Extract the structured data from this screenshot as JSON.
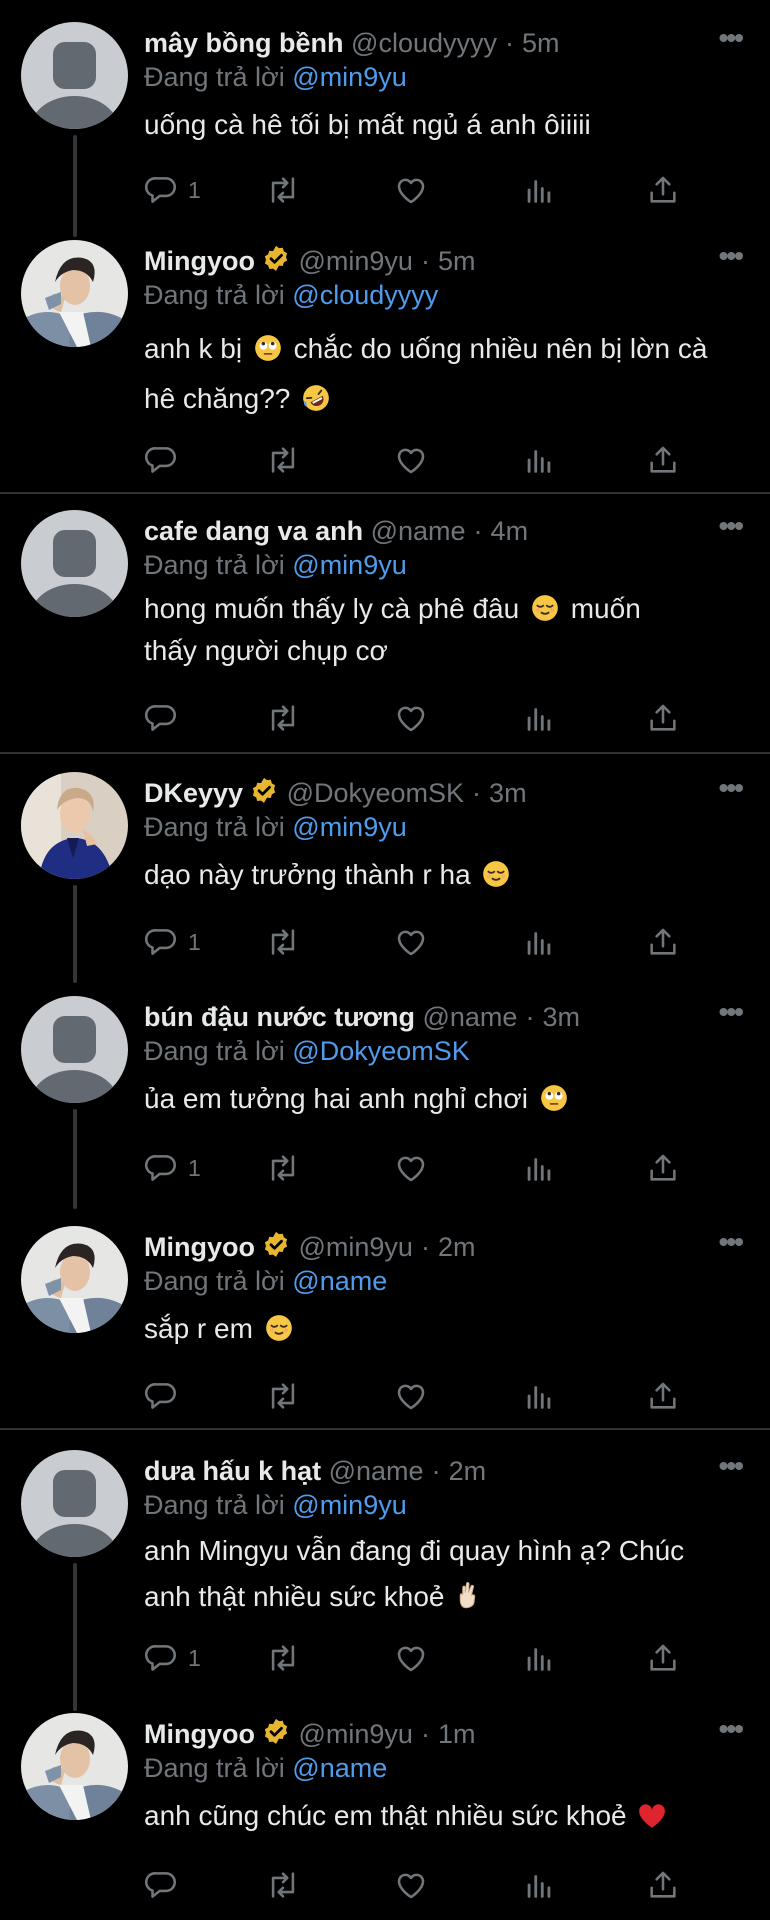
{
  "tweets": [
    {
      "name": "mây bồng bềnh",
      "handle": "@cloudyyyy",
      "time": "5m",
      "reply_prefix": "Đang trả lời",
      "reply_to": "@min9yu",
      "lines": [
        "uống cà hê tối bị mất ngủ á anh ôiiiii"
      ],
      "reply_count": "1"
    },
    {
      "name": "Mingyoo",
      "handle": "@min9yu",
      "time": "5m",
      "reply_prefix": "Đang trả lời",
      "reply_to": "@cloudyyyy",
      "lines": [
        "anh k bị",
        "chắc do uống nhiều nên bị lờn cà",
        "hê chăng??"
      ],
      "reply_count": ""
    },
    {
      "name": "cafe dang va anh",
      "handle": "@name",
      "time": "4m",
      "reply_prefix": "Đang trả lời",
      "reply_to": "@min9yu",
      "lines": [
        "hong muốn thấy ly cà phê đâu",
        "muốn",
        "thấy người chụp cơ"
      ],
      "reply_count": ""
    },
    {
      "name": "DKeyyy",
      "handle": "@DokyeomSK",
      "time": "3m",
      "reply_prefix": "Đang trả lời",
      "reply_to": "@min9yu",
      "lines": [
        "dạo này trưởng thành r ha"
      ],
      "reply_count": "1"
    },
    {
      "name": "bún đậu nước tương",
      "handle": "@name",
      "time": "3m",
      "reply_prefix": "Đang trả lời",
      "reply_to": "@DokyeomSK",
      "lines": [
        "ủa em tưởng hai anh nghỉ chơi"
      ],
      "reply_count": "1"
    },
    {
      "name": "Mingyoo",
      "handle": "@min9yu",
      "time": "2m",
      "reply_prefix": "Đang trả lời",
      "reply_to": "@name",
      "lines": [
        "sắp r em"
      ],
      "reply_count": ""
    },
    {
      "name": "dưa hấu k hạt",
      "handle": "@name",
      "time": "2m",
      "reply_prefix": "Đang trả lời",
      "reply_to": "@min9yu",
      "lines": [
        "anh Mingyu vẫn đang đi quay hình ạ? Chúc",
        "anh thật nhiều sức khoẻ"
      ],
      "reply_count": "1"
    },
    {
      "name": "Mingyoo",
      "handle": "@min9yu",
      "time": "1m",
      "reply_prefix": "Đang trả lời",
      "reply_to": "@name",
      "lines": [
        "anh cũng chúc em thật nhiều sức khoẻ"
      ],
      "reply_count": ""
    }
  ],
  "icons": {
    "more": "more-dots-icon",
    "reply": "reply-icon",
    "retweet": "retweet-icon",
    "like": "heart-icon",
    "views": "views-icon",
    "share": "share-icon",
    "verified": "verified-badge-icon"
  },
  "colors": {
    "background": "#000000",
    "text": "#e7e9ea",
    "secondary": "#71767b",
    "mention": "#4f9cec",
    "verified": "#e8b530",
    "divider": "#2f3336"
  }
}
